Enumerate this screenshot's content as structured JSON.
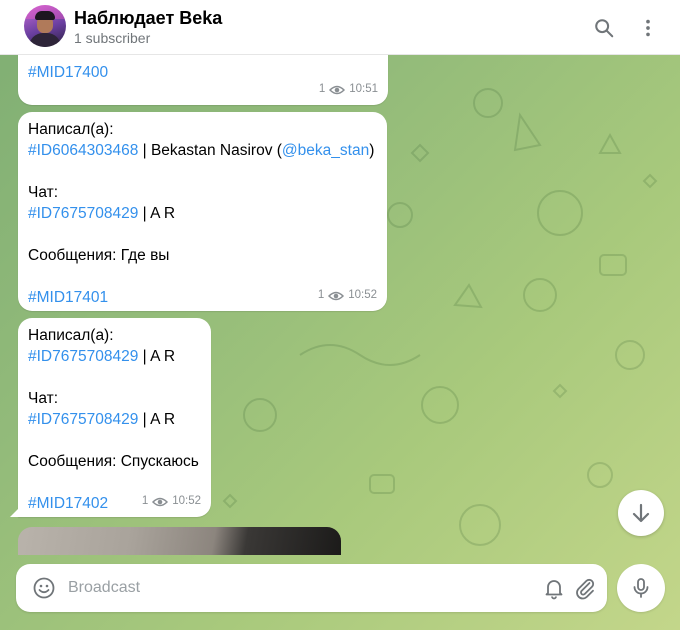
{
  "header": {
    "title": "Наблюдает Beka",
    "subtitle": "1 subscriber",
    "search_icon": "search-icon",
    "more_icon": "more-vertical-icon"
  },
  "messages": [
    {
      "lines": [
        {
          "parts": [
            {
              "text": "#MID17400",
              "tag": true
            }
          ]
        }
      ],
      "views": "1",
      "time": "10:51"
    },
    {
      "lines": [
        {
          "parts": [
            {
              "text": "Написал(а):",
              "tag": false
            }
          ]
        },
        {
          "parts": [
            {
              "text": "#ID6064303468",
              "tag": true
            },
            {
              "text": " | Bekastan Nasirov (",
              "tag": false
            },
            {
              "text": "@beka_stan",
              "tag": true
            },
            {
              "text": ")",
              "tag": false
            }
          ]
        },
        {
          "parts": []
        },
        {
          "parts": [
            {
              "text": "Чат:",
              "tag": false
            }
          ]
        },
        {
          "parts": [
            {
              "text": "#ID7675708429",
              "tag": true
            },
            {
              "text": " | A R",
              "tag": false
            }
          ]
        },
        {
          "parts": []
        },
        {
          "parts": [
            {
              "text": "Сообщения: Где вы",
              "tag": false
            }
          ]
        },
        {
          "parts": []
        },
        {
          "parts": [
            {
              "text": "#MID17401",
              "tag": true
            }
          ]
        }
      ],
      "views": "1",
      "time": "10:52"
    },
    {
      "lines": [
        {
          "parts": [
            {
              "text": "Написал(а):",
              "tag": false
            }
          ]
        },
        {
          "parts": [
            {
              "text": "#ID7675708429",
              "tag": true
            },
            {
              "text": " | A R",
              "tag": false
            }
          ]
        },
        {
          "parts": []
        },
        {
          "parts": [
            {
              "text": "Чат:",
              "tag": false
            }
          ]
        },
        {
          "parts": [
            {
              "text": "#ID7675708429",
              "tag": true
            },
            {
              "text": " | A R",
              "tag": false
            }
          ]
        },
        {
          "parts": []
        },
        {
          "parts": [
            {
              "text": "Сообщения: Спускаюсь",
              "tag": false
            }
          ]
        },
        {
          "parts": []
        },
        {
          "parts": [
            {
              "text": "#MID17402",
              "tag": true
            }
          ]
        }
      ],
      "views": "1",
      "time": "10:52"
    }
  ],
  "composer": {
    "placeholder": "Broadcast"
  },
  "colors": {
    "link": "#3390ec",
    "meta": "#8a8f93",
    "background": "#93bb7a"
  }
}
